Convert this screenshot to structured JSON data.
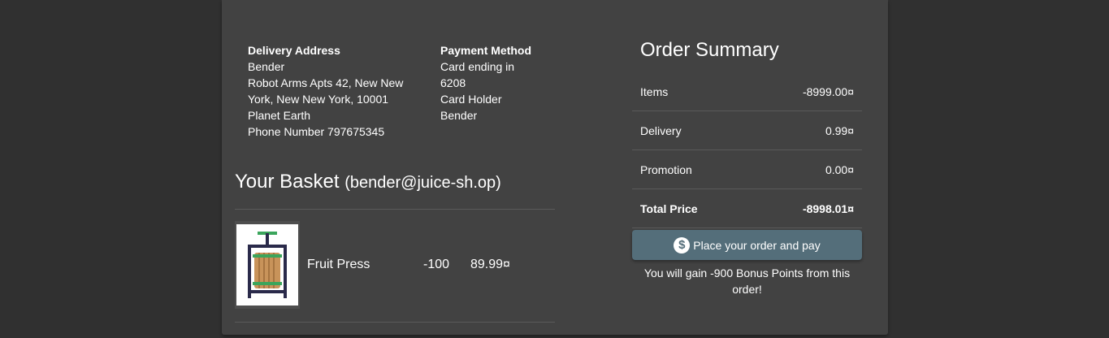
{
  "delivery": {
    "header": "Delivery Address",
    "name": "Bender",
    "street": "Robot Arms Apts 42, New New York, New New York, 10001",
    "country": "Planet Earth",
    "phone": "Phone Number 797675345"
  },
  "payment": {
    "header": "Payment Method",
    "card": "Card ending in 6208",
    "holder_label": "Card Holder",
    "holder": "Bender"
  },
  "basket": {
    "title": "Your Basket",
    "email": "(bender@juice-sh.op)",
    "items": [
      {
        "name": "Fruit Press",
        "quantity": "-100",
        "price": "89.99¤",
        "icon": "fruit-press-image"
      }
    ]
  },
  "summary": {
    "title": "Order Summary",
    "items_label": "Items",
    "items_value": "-8999.00¤",
    "delivery_label": "Delivery",
    "delivery_value": "0.99¤",
    "promotion_label": "Promotion",
    "promotion_value": "0.00¤",
    "total_label": "Total Price",
    "total_value": "-8998.01¤"
  },
  "actions": {
    "place_order_label": "Place your order and pay",
    "place_order_icon": "dollar-circle-icon"
  },
  "bonus": "You will gain -900 Bonus Points from this order!",
  "colors": {
    "page_bg": "#303030",
    "card_bg": "#424242",
    "button_bg": "#546e7a"
  }
}
